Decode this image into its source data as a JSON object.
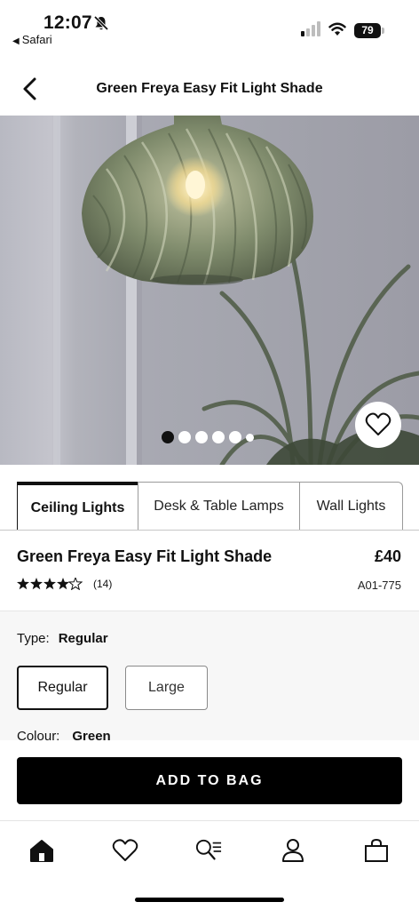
{
  "status_bar": {
    "time": "12:07",
    "back_app": "Safari",
    "battery": "79"
  },
  "header": {
    "title": "Green Freya Easy Fit Light Shade"
  },
  "gallery": {
    "image_count": 6,
    "active_index": 0
  },
  "tabs": [
    {
      "label": "Ceiling Lights",
      "active": true
    },
    {
      "label": "Desk & Table Lamps",
      "active": false
    },
    {
      "label": "Wall Lights",
      "active": false
    }
  ],
  "product": {
    "name": "Green Freya Easy Fit Light Shade",
    "price": "£40",
    "rating_stars": 4.5,
    "review_count": "(14)",
    "sku": "A01-775"
  },
  "options": {
    "type_label": "Type:",
    "type_value": "Regular",
    "choices": [
      "Regular",
      "Large"
    ],
    "colour_label": "Colour:",
    "colour_value": "Green"
  },
  "actions": {
    "add_to_bag": "ADD TO BAG"
  },
  "bottom_nav": [
    "home-icon",
    "heart-icon",
    "search-list-icon",
    "account-icon",
    "bag-icon"
  ]
}
